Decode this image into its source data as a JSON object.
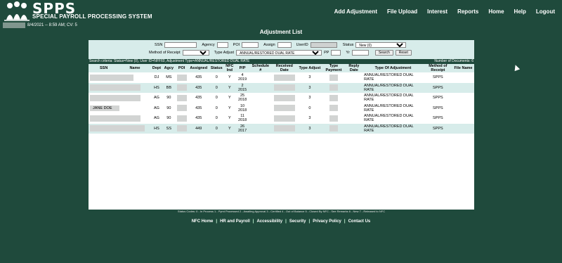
{
  "app": {
    "logo_text": "SPPS",
    "subtitle": "SPECIAL PAYROLL PROCESSING SYSTEM",
    "session_info": "8/4/2021 -- 8:59 AM; CV: 5"
  },
  "nav": [
    "Add Adjustment",
    "File Upload",
    "Interest",
    "Reports",
    "Home",
    "Help",
    "Logout"
  ],
  "page_title": "Adjustment List",
  "filters": {
    "ssn_label": "SSN",
    "agency_label": "Agency",
    "poi_label": "POI",
    "assign_label": "Assign",
    "userid_label": "UserID",
    "status_label": "Status",
    "status_value": "New (0)",
    "method_label": "Method of Receipt",
    "method_value": "",
    "type_adjust_label": "Type Adjust",
    "type_adjust_value": "ANNUAL/RESTORED DUAL RATE",
    "pp_label": "PP",
    "yr_label": "Yr",
    "search_button": "Search",
    "reset_button": "Reset"
  },
  "criteria": {
    "text": "Search criteria: Status=New (0), User ID=NFF60, Adjustment Type=ANNUAL/RESTORED DUAL RATE",
    "count": "Number of Documents: 6"
  },
  "table": {
    "headers": [
      "SSN",
      "Name",
      "Dept",
      "Agcy",
      "POI",
      "Assigned",
      "Status",
      "NFC Ind",
      "P/P",
      "Schedule #",
      "Received Date",
      "Type Adjust",
      "Type Payment",
      "Reply Date",
      "Type Of Adjustment",
      "Method of Receipt",
      "File Name"
    ],
    "rows": [
      {
        "ssn": "",
        "name": "",
        "dept": "DJ",
        "agcy": "MS",
        "poi": "",
        "assigned": "435",
        "status": "0",
        "nfc": "Y",
        "pp": "4 2019",
        "schedule": "",
        "received": "",
        "type_adjust": "3",
        "type_payment": "",
        "reply": "",
        "type_of_adj": "ANNUAL/RESTORED DUAL RATE",
        "method": "SPPS",
        "file": ""
      },
      {
        "ssn": "",
        "name": "",
        "dept": "HS",
        "agcy": "BB",
        "poi": "",
        "assigned": "435",
        "status": "0",
        "nfc": "Y",
        "pp": "2 2015",
        "schedule": "",
        "received": "",
        "type_adjust": "3",
        "type_payment": "",
        "reply": "",
        "type_of_adj": "ANNUAL/RESTORED DUAL RATE",
        "method": "SPPS",
        "file": ""
      },
      {
        "ssn": "",
        "name": "",
        "dept": "AG",
        "agcy": "90",
        "poi": "",
        "assigned": "435",
        "status": "0",
        "nfc": "Y",
        "pp": "25 2018",
        "schedule": "",
        "received": "",
        "type_adjust": "3",
        "type_payment": "",
        "reply": "",
        "type_of_adj": "ANNUAL/RESTORED DUAL RATE",
        "method": "SPPS",
        "file": ""
      },
      {
        "ssn": "JANE DOE",
        "name": "",
        "dept": "AG",
        "agcy": "90",
        "poi": "",
        "assigned": "435",
        "status": "0",
        "nfc": "Y",
        "pp": "10 2018",
        "schedule": "",
        "received": "",
        "type_adjust": "0",
        "type_payment": "",
        "reply": "",
        "type_of_adj": "ANNUAL/RESTORED DUAL RATE",
        "method": "SPPS",
        "file": ""
      },
      {
        "ssn": "",
        "name": "",
        "dept": "AG",
        "agcy": "90",
        "poi": "",
        "assigned": "435",
        "status": "0",
        "nfc": "Y",
        "pp": "11 2018",
        "schedule": "",
        "received": "",
        "type_adjust": "3",
        "type_payment": "",
        "reply": "",
        "type_of_adj": "ANNUAL/RESTORED DUAL RATE",
        "method": "SPPS",
        "file": ""
      },
      {
        "ssn": "",
        "name": "",
        "dept": "HS",
        "agcy": "SS",
        "poi": "",
        "assigned": "449",
        "status": "0",
        "nfc": "Y",
        "pp": "26 2017",
        "schedule": "",
        "received": "",
        "type_adjust": "3",
        "type_payment": "",
        "reply": "",
        "type_of_adj": "ANNUAL/RESTORED DUAL RATE",
        "method": "SPPS",
        "file": ""
      }
    ]
  },
  "status_codes": "Status Codes: 0 - In Process 1 - Pymt Processed 2 - Awaiting Approval 3 - Certified 4 - Out of Balance 5 - Closed By NFC - See Remarks 6 - New 7 - Released to NFC",
  "footer_links": [
    "NFC Home",
    "HR and Payroll",
    "Accessibility",
    "Security",
    "Privacy Policy",
    "Contact Us"
  ],
  "colors": {
    "background": "#1f4a3c",
    "light_row": "#d7ecea"
  }
}
